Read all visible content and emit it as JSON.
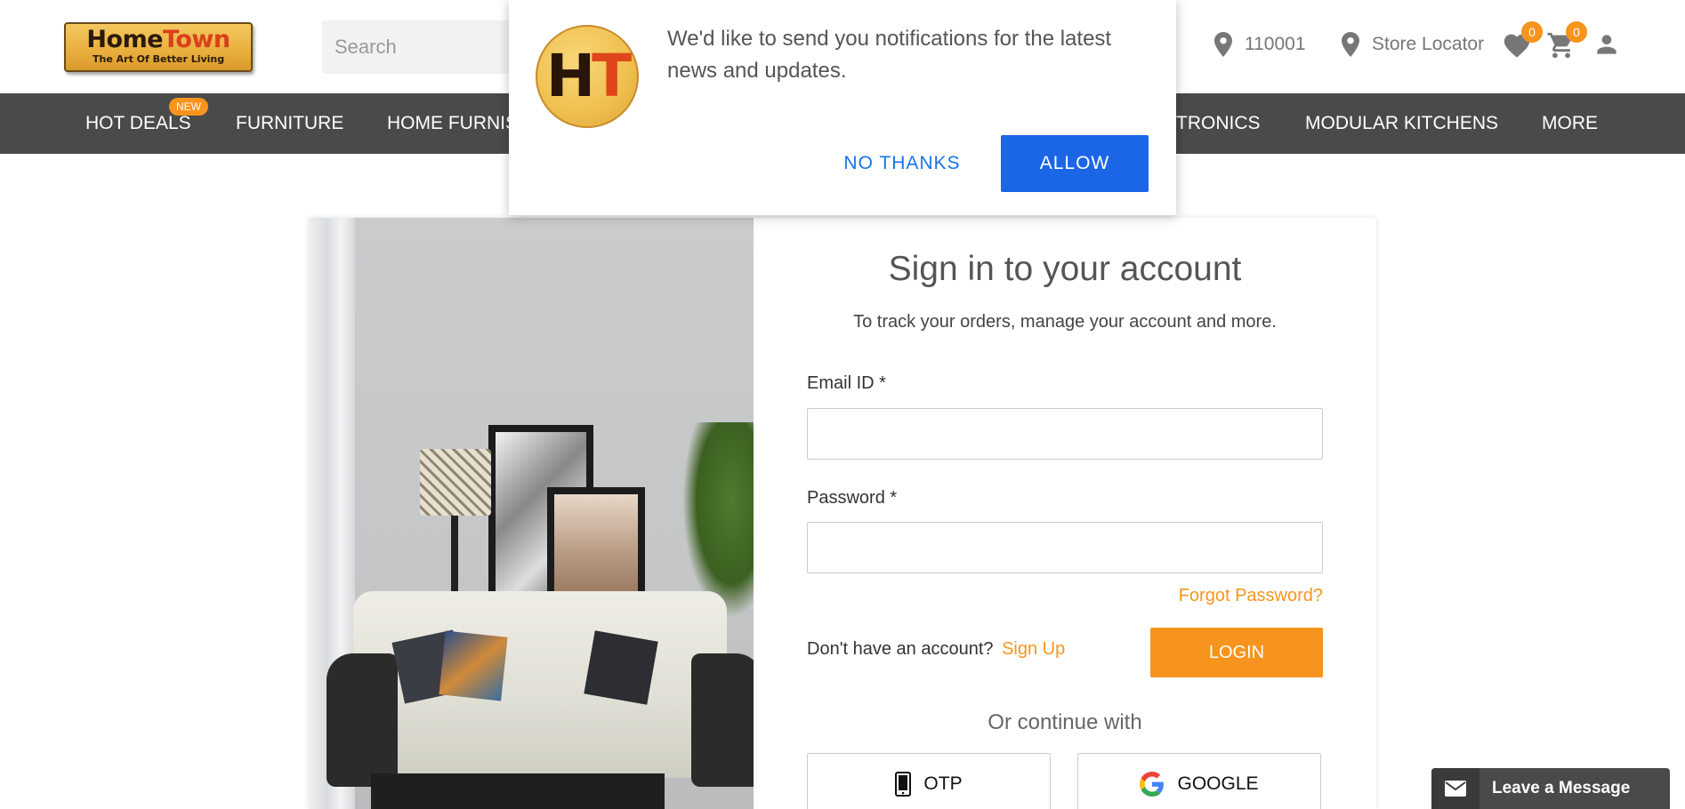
{
  "header": {
    "logo": {
      "brand_home": "Home",
      "brand_town": "Town",
      "tagline": "The Art Of Better Living"
    },
    "search": {
      "placeholder": "Search"
    },
    "pincode": "110001",
    "store_locator": "Store Locator",
    "wishlist_count": "0",
    "cart_count": "0"
  },
  "nav": {
    "items": [
      {
        "label": "HOT DEALS",
        "badge": "NEW"
      },
      {
        "label": "FURNITURE"
      },
      {
        "label": "HOME FURNIS"
      },
      {
        "label": "TRONICS"
      },
      {
        "label": "MODULAR KITCHENS"
      },
      {
        "label": "MORE"
      }
    ]
  },
  "notification": {
    "logo_text_h": "H",
    "logo_text_t": "T",
    "message": "We'd like to send you notifications for the latest news and updates.",
    "no_thanks": "NO THANKS",
    "allow": "ALLOW"
  },
  "login": {
    "title": "Sign in to your account",
    "subtitle": "To track your orders, manage your account and more.",
    "email_label": "Email ID *",
    "email_value": "",
    "password_label": "Password *",
    "password_value": "",
    "forgot": "Forgot Password?",
    "no_account": "Don't have an account?",
    "signup": "Sign Up",
    "login_button": "LOGIN",
    "or_continue": "Or continue with",
    "otp": "OTP",
    "google": "GOOGLE"
  },
  "chat_widget": {
    "label": "Leave a Message"
  },
  "colors": {
    "accent": "#f7941d",
    "nav_bg": "#4a4a4a",
    "allow_blue": "#1a66e6",
    "link_blue": "#1a73e8"
  }
}
